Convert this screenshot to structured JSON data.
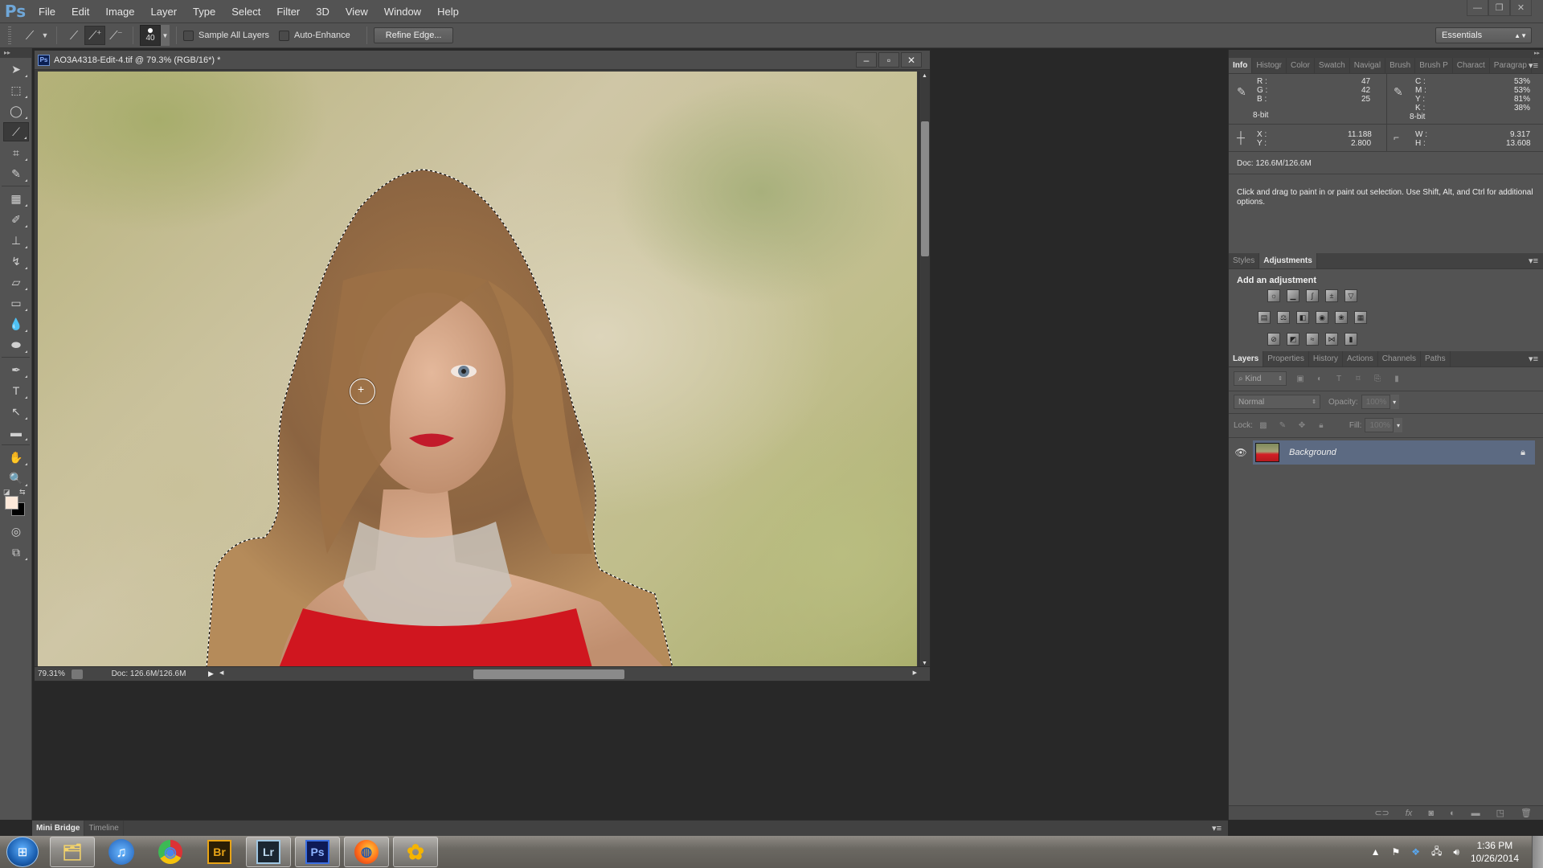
{
  "app": {
    "logo": "Ps",
    "menu": [
      "File",
      "Edit",
      "Image",
      "Layer",
      "Type",
      "Select",
      "Filter",
      "3D",
      "View",
      "Window",
      "Help"
    ],
    "window_controls": [
      "—",
      "❐",
      "✕"
    ]
  },
  "options_bar": {
    "brush_size": "40",
    "sample_all_layers": {
      "label": "Sample All Layers",
      "checked": false
    },
    "auto_enhance": {
      "label": "Auto-Enhance",
      "checked": false
    },
    "refine_edge": "Refine Edge...",
    "workspace": "Essentials"
  },
  "document": {
    "title": "AO3A4318-Edit-4.tif @ 79.3% (RGB/16*) *",
    "zoom": "79.31%",
    "doc_size": "Doc: 126.6M/126.6M",
    "buttons": [
      "‒",
      "▫",
      "✕"
    ],
    "colors": {
      "selection_dress": "#d0161f"
    }
  },
  "toolbar": {
    "tools": [
      "move",
      "rectangular-marquee",
      "lasso",
      "quick-selection",
      "crop",
      "eyedropper",
      "spot-healing",
      "brush",
      "clone-stamp",
      "history-brush",
      "eraser",
      "gradient",
      "blur",
      "dodge",
      "pen",
      "type",
      "path-selection",
      "rectangle",
      "hand",
      "zoom"
    ],
    "foreground_color": "#fde9da",
    "background_color": "#000000"
  },
  "info_panel": {
    "tabs": [
      "Info",
      "Histogr",
      "Color",
      "Swatch",
      "Navigal",
      "Brush",
      "Brush P",
      "Charact",
      "Paragrap"
    ],
    "rgb": {
      "R": "47",
      "G": "42",
      "B": "25",
      "mode": "8-bit"
    },
    "cmyk": {
      "C": "53%",
      "M": "53%",
      "Y": "81%",
      "K": "38%",
      "mode": "8-bit"
    },
    "xy": {
      "X": "11.188",
      "Y": "2.800"
    },
    "wh": {
      "W": "9.317",
      "H": "13.608"
    },
    "doc": "Doc: 126.6M/126.6M",
    "hint": "Click and drag to paint in or paint out selection.  Use Shift, Alt, and Ctrl for additional options."
  },
  "adjustments_panel": {
    "tabs": [
      "Styles",
      "Adjustments"
    ],
    "title": "Add an adjustment",
    "rows": [
      [
        "brightness-contrast",
        "levels",
        "curves",
        "exposure",
        "vibrance"
      ],
      [
        "hue-saturation",
        "color-balance",
        "black-white",
        "photo-filter",
        "channel-mixer",
        "color-lookup"
      ],
      [
        "invert",
        "posterize",
        "threshold",
        "selective-color",
        "gradient-map"
      ]
    ]
  },
  "layers_panel": {
    "tabs": [
      "Layers",
      "Properties",
      "History",
      "Actions",
      "Channels",
      "Paths"
    ],
    "filter": "Kind",
    "blend_mode": "Normal",
    "opacity_label": "Opacity:",
    "opacity": "100%",
    "lock_label": "Lock:",
    "fill_label": "Fill:",
    "fill": "100%",
    "layers": [
      {
        "name": "Background",
        "visible": true,
        "locked": true
      }
    ]
  },
  "bottom_panel": {
    "tabs": [
      "Mini Bridge",
      "Timeline"
    ]
  },
  "taskbar": {
    "apps": [
      {
        "name": "explorer",
        "label": "🗂",
        "open": true
      },
      {
        "name": "itunes",
        "label": "♫",
        "open": false
      },
      {
        "name": "chrome",
        "label": "◉",
        "open": false
      },
      {
        "name": "bridge",
        "label": "Br",
        "open": false
      },
      {
        "name": "lightroom",
        "label": "Lr",
        "open": true
      },
      {
        "name": "photoshop",
        "label": "Ps",
        "open": true
      },
      {
        "name": "firefox",
        "label": "◍",
        "open": true
      },
      {
        "name": "app-flower",
        "label": "✿",
        "open": true
      }
    ],
    "time": "1:36 PM",
    "date": "10/26/2014"
  }
}
